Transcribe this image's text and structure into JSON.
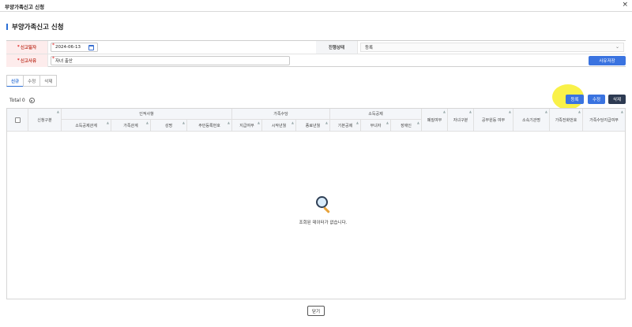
{
  "window": {
    "title": "부양가족신고 신청",
    "close_glyph": "×"
  },
  "page": {
    "heading": "부양가족신고 신청"
  },
  "form": {
    "report_date_label": "신고일자",
    "report_date_value": "2024-06-13",
    "status_label": "진행상태",
    "status_value": "등록",
    "reason_label": "신고사유",
    "reason_value": "자녀 출산",
    "reason_register_button": "사유저장"
  },
  "tabs": [
    {
      "label": "신규",
      "active": true
    },
    {
      "label": "수정",
      "active": false
    },
    {
      "label": "삭제",
      "active": false
    }
  ],
  "grid_toolbar": {
    "total_label": "Total 0",
    "register_button": "등록",
    "modify_button": "수정",
    "delete_button": "삭제"
  },
  "grid": {
    "group_headers": {
      "personal": "인적사항",
      "family_allowance": "가족수당",
      "income_deduction": "소득공제"
    },
    "columns": {
      "apply_type": "신청구분",
      "income_relation": "소득공제관계",
      "family_relation": "가족관계",
      "name": "성명",
      "resident_no": "주민등록번호",
      "pay_flag": "지급여부",
      "start_ym": "시작년월",
      "end_ym": "종료년월",
      "basic_deduction": "기본공제",
      "single_parent": "부녀자",
      "disabled": "장애인",
      "abolish_flag": "폐질여부",
      "child_type": "자녀구분",
      "civil_servant": "공무원등 여부",
      "affiliation": "소속기관명",
      "family_phone": "가족전화번호",
      "allowance_pay_flag": "가족수당지급여부"
    },
    "empty_message": "조회된 데이터가 없습니다."
  },
  "footer": {
    "close_button": "닫기"
  },
  "colors": {
    "accent": "#3a73e0",
    "dark_button": "#2d3a52",
    "required": "#e02020",
    "highlight": "#f8f03a"
  }
}
